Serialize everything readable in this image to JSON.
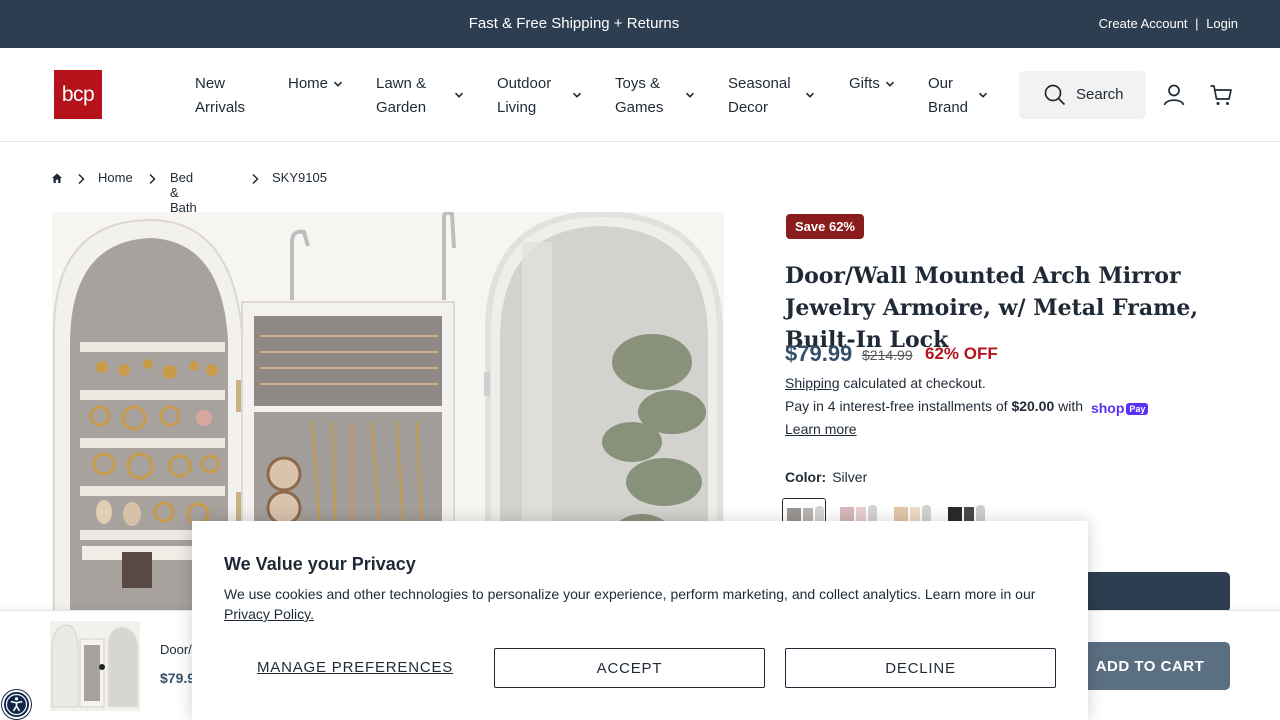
{
  "announcement": {
    "message": "Fast & Free Shipping + Returns",
    "create_account": "Create Account",
    "separator": "|",
    "login": "Login"
  },
  "brand": {
    "logo_text": "bcp",
    "logo_color": "#b5121b"
  },
  "nav": {
    "items": [
      {
        "line1": "New",
        "line2": "Arrivals"
      },
      {
        "line1": "Home",
        "line2": ""
      },
      {
        "line1": "Lawn &",
        "line2": "Garden"
      },
      {
        "line1": "Outdoor",
        "line2": "Living"
      },
      {
        "line1": "Toys &",
        "line2": "Games"
      },
      {
        "line1": "Seasonal",
        "line2": "Decor"
      },
      {
        "line1": "Gifts",
        "line2": ""
      },
      {
        "line1": "Our",
        "line2": "Brand"
      }
    ],
    "search_label": "Search",
    "icons": [
      "search-icon",
      "account-icon",
      "cart-icon",
      "chevron-down-icon",
      "home-icon",
      "chevron-right-icon"
    ]
  },
  "breadcrumb": {
    "home": "Home",
    "category": "Bed & Bath",
    "current": "SKY9105"
  },
  "product": {
    "badge": "Save 62%",
    "title": "Door/Wall Mounted Arch Mirror Jewelry Armoire, w/ Metal Frame, Built-In Lock",
    "price": "$79.99",
    "compare_price": "$214.99",
    "discount": "62% OFF",
    "shipping_link": "Shipping",
    "shipping_text": "calculated at checkout.",
    "installments_pre": "Pay in 4 interest-free installments of",
    "installment_amount": "$20.00",
    "installments_post": "with",
    "shoppay_label": "shop",
    "shoppay_pay": "Pay",
    "learn_more": "Learn more",
    "color_label": "Color:",
    "color_value": "Silver"
  },
  "sticky": {
    "name": "Door/",
    "price": "$79.9",
    "add_to_cart": "ADD TO CART"
  },
  "cookie": {
    "heading": "We Value your Privacy",
    "body": "We use cookies and other technologies to personalize your experience, perform marketing, and collect analytics. Learn more in our",
    "policy_link": "Privacy Policy.",
    "manage": "MANAGE PREFERENCES",
    "accept": "ACCEPT",
    "decline": "DECLINE"
  },
  "colors": {
    "topbar": "#2d3e50",
    "accent_price": "#36506b",
    "sale_red": "#b5121b",
    "badge_bg": "#8a1c1c",
    "shoppay": "#5a31f4"
  }
}
